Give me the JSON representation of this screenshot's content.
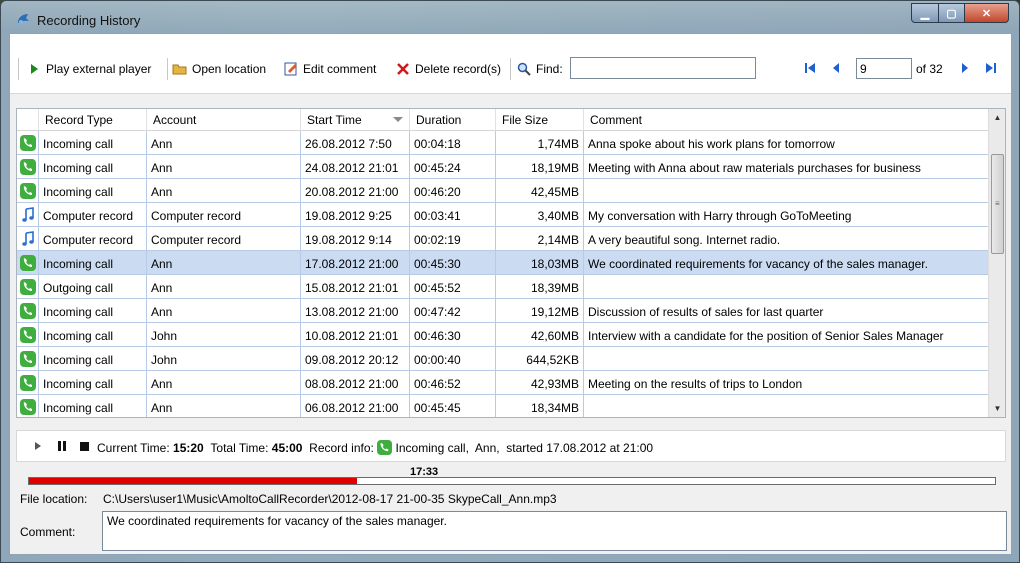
{
  "window": {
    "title": "Recording History"
  },
  "toolbar": {
    "play_label": "Play external player",
    "open_label": "Open location",
    "edit_label": "Edit comment",
    "delete_label": "Delete record(s)",
    "find_label": "Find:",
    "find_value": "",
    "page_value": "9",
    "page_of": "of 32"
  },
  "table": {
    "columns": [
      "Record Type",
      "Account",
      "Start Time",
      "Duration",
      "File Size",
      "Comment"
    ],
    "rows": [
      {
        "icon": "phone",
        "type": "Incoming call",
        "account": "Ann",
        "start": "26.08.2012 7:50",
        "duration": "00:04:18",
        "size": "1,74MB",
        "comment": "Anna spoke about his work plans for tomorrow"
      },
      {
        "icon": "phone",
        "type": "Incoming call",
        "account": "Ann",
        "start": "24.08.2012 21:01",
        "duration": "00:45:24",
        "size": "18,19MB",
        "comment": "Meeting with Anna about raw materials purchases for business"
      },
      {
        "icon": "phone",
        "type": "Incoming call",
        "account": "Ann",
        "start": "20.08.2012 21:00",
        "duration": "00:46:20",
        "size": "42,45MB",
        "comment": ""
      },
      {
        "icon": "note",
        "type": "Computer record",
        "account": "Computer record",
        "start": "19.08.2012 9:25",
        "duration": "00:03:41",
        "size": "3,40MB",
        "comment": "My conversation with Harry through GoToMeeting"
      },
      {
        "icon": "note",
        "type": "Computer record",
        "account": "Computer record",
        "start": "19.08.2012 9:14",
        "duration": "00:02:19",
        "size": "2,14MB",
        "comment": "A very beautiful song. Internet radio."
      },
      {
        "icon": "phone",
        "type": "Incoming call",
        "account": "Ann",
        "start": "17.08.2012 21:00",
        "duration": "00:45:30",
        "size": "18,03MB",
        "comment": "We coordinated requirements for vacancy of the sales manager.",
        "selected": true
      },
      {
        "icon": "phone",
        "type": "Outgoing call",
        "account": "Ann",
        "start": "15.08.2012 21:01",
        "duration": "00:45:52",
        "size": "18,39MB",
        "comment": ""
      },
      {
        "icon": "phone",
        "type": "Incoming call",
        "account": "Ann",
        "start": "13.08.2012 21:00",
        "duration": "00:47:42",
        "size": "19,12MB",
        "comment": "Discussion of results of sales for last quarter"
      },
      {
        "icon": "phone",
        "type": "Incoming call",
        "account": "John",
        "start": "10.08.2012 21:01",
        "duration": "00:46:30",
        "size": "42,60MB",
        "comment": "Interview with a candidate for the position of Senior Sales Manager"
      },
      {
        "icon": "phone",
        "type": "Incoming call",
        "account": "John",
        "start": "09.08.2012 20:12",
        "duration": "00:00:40",
        "size": "644,52KB",
        "comment": ""
      },
      {
        "icon": "phone",
        "type": "Incoming call",
        "account": "Ann",
        "start": "08.08.2012 21:00",
        "duration": "00:46:52",
        "size": "42,93MB",
        "comment": "Meeting on the results of trips to London"
      },
      {
        "icon": "phone",
        "type": "Incoming call",
        "account": "Ann",
        "start": "06.08.2012 21:00",
        "duration": "00:45:45",
        "size": "18,34MB",
        "comment": ""
      }
    ]
  },
  "player": {
    "current_label": "Current Time:",
    "current_value": "15:20",
    "total_label": "Total Time:",
    "total_value": "45:00",
    "info_label": "Record info:",
    "info_value": "Incoming call,  Ann,  started 17.08.2012 at 21:00",
    "position": "17:33",
    "progress_fraction": 0.34
  },
  "details": {
    "file_label": "File location:",
    "file_path": "C:\\Users\\user1\\Music\\AmoltoCallRecorder\\2012-08-17 21-00-35 SkypeCall_Ann.mp3",
    "comment_label": "Comment:",
    "comment_value": "We coordinated requirements for vacancy of the sales manager."
  },
  "colors": {
    "selection": "#cbdcf2",
    "grid_line": "#b7cbe6",
    "progress": "#e00000",
    "nav_blue": "#1f5fd0"
  }
}
